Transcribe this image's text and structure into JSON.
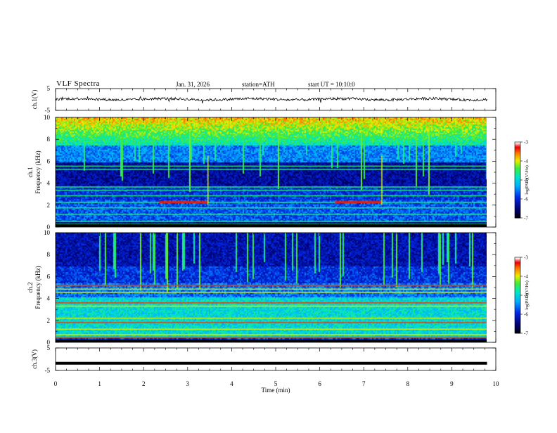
{
  "header": {
    "title": "VLF Spectra",
    "date": "Jan. 31, 2026",
    "station": "station=ATH",
    "start_ut": "start UT =  10:10:0"
  },
  "chart_data": [
    {
      "type": "line",
      "name": "ch1-waveform",
      "ylabel": "ch.1(V)",
      "ylim": [
        -5,
        5
      ],
      "yticks": [
        5,
        -5
      ],
      "xlim": [
        0,
        10
      ],
      "x_range": [
        0,
        9.8
      ],
      "baseline_v": 0.1,
      "noise_v": 0.6
    },
    {
      "type": "heatmap",
      "name": "ch1-spectrogram",
      "ylabel": "ch.1\nFrequency (kHz)",
      "ylim": [
        0,
        10
      ],
      "yticks": [
        0,
        2,
        4,
        6,
        8,
        10
      ],
      "x_range": [
        0,
        9.8
      ],
      "colorbar": {
        "label": "log(PSD)(V²/Hz)",
        "ticks": [
          -3,
          -4,
          -5,
          -6,
          -7
        ],
        "range": [
          -7,
          -3
        ]
      },
      "tones_khz": [
        0.3,
        0.55,
        1.2,
        1.8,
        2.3,
        2.9,
        3.4,
        3.7,
        5.3,
        5.6
      ],
      "bursts": [
        {
          "t": [
            2.35,
            3.45
          ],
          "khz": 2.3
        },
        {
          "t": [
            6.35,
            7.4
          ],
          "khz": 2.3
        }
      ]
    },
    {
      "type": "heatmap",
      "name": "ch2-spectrogram",
      "ylabel": "ch.2\nFrequency (kHz)",
      "ylim": [
        0,
        10
      ],
      "yticks": [
        0,
        2,
        4,
        6,
        8,
        10
      ],
      "x_range": [
        0,
        9.8
      ],
      "colorbar": {
        "label": "log(PSD)(V²/Hz)",
        "ticks": [
          -3,
          -4,
          -5,
          -6,
          -7
        ],
        "range": [
          -7,
          -3
        ]
      },
      "tones_khz": [
        0.5,
        0.75,
        1.25,
        1.85,
        2.25,
        3.35,
        3.65,
        4.6,
        4.9,
        5.25
      ]
    },
    {
      "type": "line",
      "name": "ch3-waveform",
      "ylabel": "ch.3(V)",
      "ylim": [
        -5,
        5
      ],
      "yticks": [
        5,
        -5
      ],
      "xlim": [
        0,
        10
      ],
      "x_range": [
        0,
        9.8
      ],
      "baseline_v": -1.8
    }
  ],
  "xaxis": {
    "label": "Time (min)",
    "ticks": [
      "0",
      "1",
      "2",
      "3",
      "4",
      "5",
      "6",
      "7",
      "8",
      "9",
      "10"
    ]
  }
}
